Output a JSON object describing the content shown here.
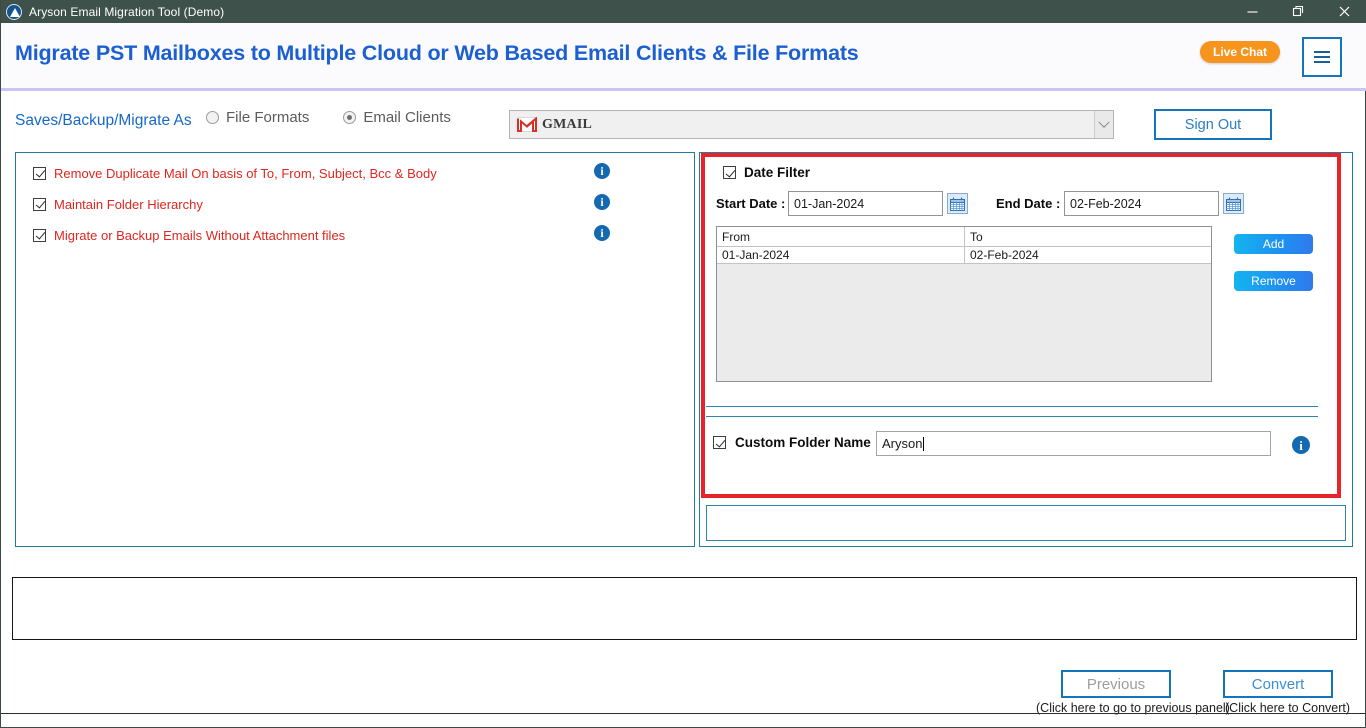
{
  "window": {
    "title": "Aryson Email Migration Tool (Demo)",
    "logo_icon": "aryson-logo-icon",
    "controls": {
      "minimize": "minimize-icon",
      "maximize": "maximize-restore-icon",
      "close": "close-icon"
    }
  },
  "banner": {
    "title": "Migrate PST Mailboxes to Multiple Cloud or Web Based Email Clients & File Formats",
    "live_chat_label": "Live Chat",
    "menu_icon": "hamburger-menu-icon",
    "title_color": "#1b5fd0",
    "live_chat_color": "#f7941e"
  },
  "options_row": {
    "saves_label": "Saves/Backup/Migrate As",
    "radios": [
      {
        "label": "File Formats",
        "selected": false
      },
      {
        "label": "Email Clients",
        "selected": true
      }
    ],
    "client_select": {
      "value": "GMAIL",
      "icon": "gmail-icon",
      "arrow_icon": "chevron-down-icon"
    },
    "sign_out_label": "Sign Out"
  },
  "left_panel": {
    "options": [
      {
        "label": "Remove Duplicate Mail On basis of To, From, Subject, Bcc & Body",
        "checked": true
      },
      {
        "label": "Maintain Folder Hierarchy",
        "checked": true
      },
      {
        "label": "Migrate or Backup Emails Without Attachment files",
        "checked": true
      }
    ],
    "info_icon": "info-icon",
    "label_color": "#e0261f"
  },
  "right_panel": {
    "date_filter": {
      "label": "Date Filter",
      "checked": true,
      "start_label": "Start Date :",
      "start_value": "01-Jan-2024",
      "end_label": "End Date :",
      "end_value": "02-Feb-2024",
      "calendar_icon": "calendar-icon"
    },
    "date_table": {
      "columns": [
        "From",
        "To"
      ],
      "rows": [
        [
          "01-Jan-2024",
          "02-Feb-2024"
        ]
      ]
    },
    "buttons": {
      "add_label": "Add",
      "remove_label": "Remove"
    },
    "custom_folder": {
      "label": "Custom Folder Name",
      "checked": true,
      "value": "Aryson",
      "info_icon": "info-icon"
    },
    "highlight_color": "#e8232a"
  },
  "log_panel": {
    "content": ""
  },
  "footer": {
    "previous_label": "Previous",
    "previous_hint": "(Click here to go to previous panel)",
    "previous_enabled": false,
    "convert_label": "Convert",
    "convert_hint": "(Click here to Convert)",
    "convert_enabled": true
  }
}
